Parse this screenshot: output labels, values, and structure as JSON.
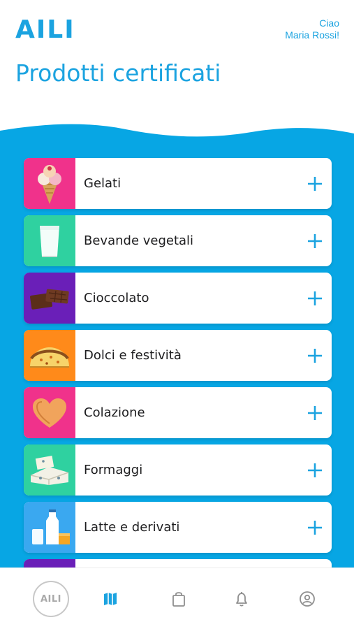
{
  "header": {
    "logo": "AILI",
    "greeting_line1": "Ciao",
    "greeting_line2": "Maria Rossi!",
    "title": "Prodotti certificati"
  },
  "categories": [
    {
      "label": "Gelati",
      "color": "#f0328b",
      "icon": "ice-cream-icon"
    },
    {
      "label": "Bevande vegetali",
      "color": "#2fd1a0",
      "icon": "milk-glass-icon"
    },
    {
      "label": "Cioccolato",
      "color": "#6a1fb8",
      "icon": "chocolate-icon"
    },
    {
      "label": "Dolci e festività",
      "color": "#ff8a1a",
      "icon": "panettone-icon"
    },
    {
      "label": "Colazione",
      "color": "#f0328b",
      "icon": "heart-cookie-icon"
    },
    {
      "label": "Formaggi",
      "color": "#2fd1a0",
      "icon": "cheese-icon"
    },
    {
      "label": "Latte e derivati",
      "color": "#3aa8f0",
      "icon": "milk-bottle-icon"
    },
    {
      "label": "",
      "color": "#6a1fb8",
      "icon": "partial-item-icon"
    }
  ],
  "nav": {
    "logo_button": "AILI",
    "items": [
      "map-icon",
      "shopping-bag-icon",
      "bell-icon",
      "profile-icon"
    ],
    "active": "map-icon"
  },
  "colors": {
    "brand": "#1ba3e0",
    "blue_background": "#07a6e4"
  }
}
